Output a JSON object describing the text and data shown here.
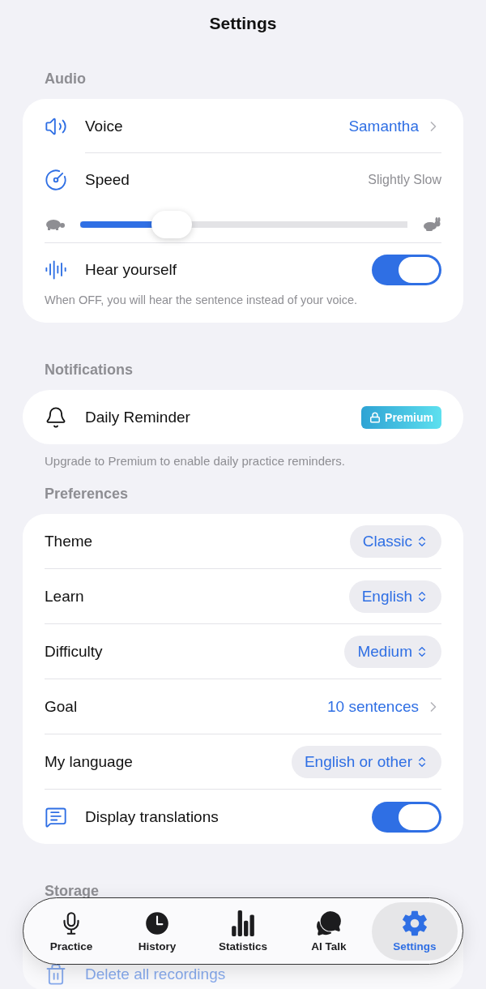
{
  "title": "Settings",
  "sections": [
    {
      "header": "Audio",
      "rows": [
        {
          "kind": "link",
          "label": "Voice",
          "value": "Samantha"
        },
        {
          "kind": "slider",
          "label": "Speed",
          "reading": "Slightly Slow",
          "level": 0.28
        },
        {
          "kind": "toggle",
          "label": "Hear yourself",
          "on": true,
          "hint": "When OFF, you will hear the sentence instead of your voice."
        }
      ]
    },
    {
      "header": "Notifications",
      "rows": [
        {
          "kind": "premium",
          "label": "Daily Reminder",
          "badge": "Premium"
        }
      ],
      "note": "Upgrade to Premium to enable daily practice reminders."
    },
    {
      "header": "Preferences",
      "rows": [
        {
          "kind": "picker",
          "label": "Theme",
          "value": "Classic"
        },
        {
          "kind": "picker",
          "label": "Learn",
          "value": "English"
        },
        {
          "kind": "picker",
          "label": "Difficulty",
          "value": "Medium"
        },
        {
          "kind": "link",
          "label": "Goal",
          "value": "10 sentences"
        },
        {
          "kind": "picker",
          "label": "My language",
          "value": "English or other"
        },
        {
          "kind": "toggle",
          "label": "Display translations",
          "on": true
        }
      ]
    },
    {
      "header": "Storage",
      "rows": [
        {
          "kind": "action",
          "label": "Delete all recordings"
        }
      ]
    }
  ],
  "tab_bar": [
    {
      "label": "Practice",
      "selected": false
    },
    {
      "label": "History",
      "selected": false
    },
    {
      "label": "Statistics",
      "selected": false
    },
    {
      "label": "AI Talk",
      "selected": false
    },
    {
      "label": "Settings",
      "selected": true
    }
  ]
}
